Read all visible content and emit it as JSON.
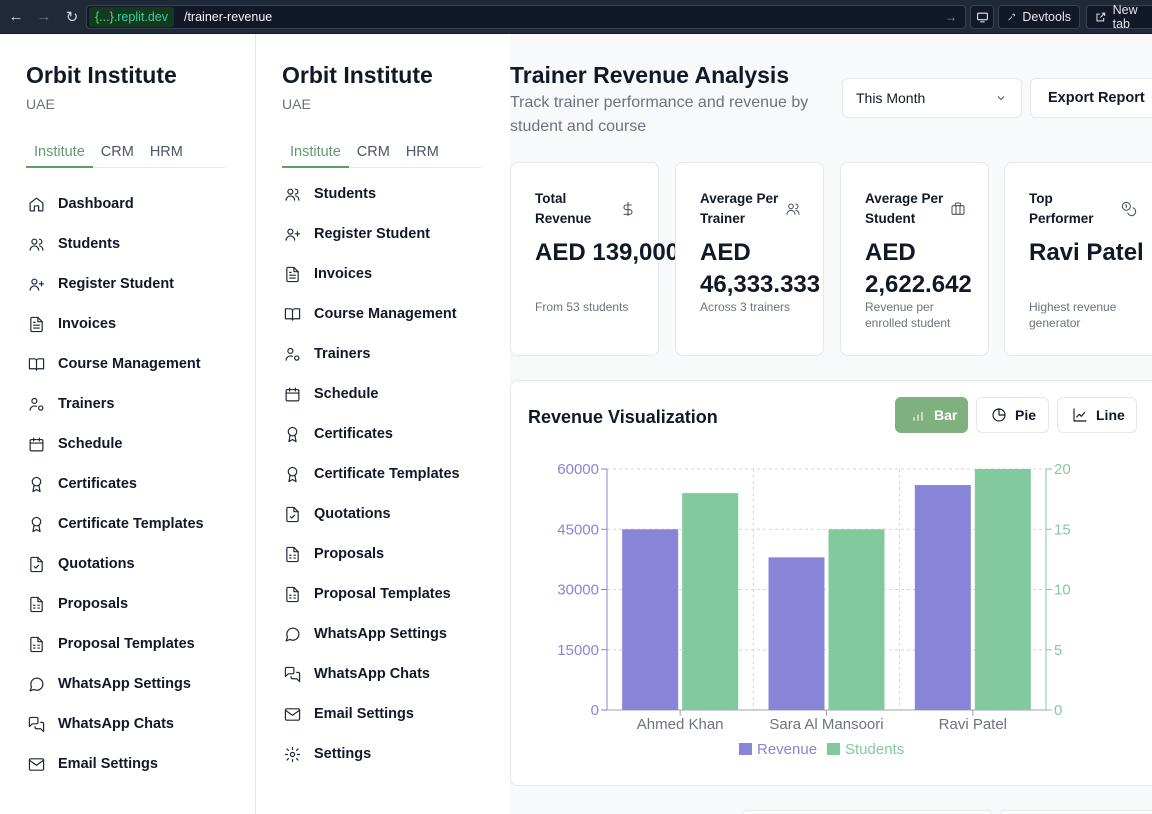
{
  "browser": {
    "url_domain_brace": "{...}",
    "url_domain": ".replit.dev",
    "url_path": "/trainer-revenue",
    "devtools_label": "Devtools",
    "newtab_label": "New tab"
  },
  "sidebar": {
    "title": "Orbit Institute",
    "subtitle": "UAE",
    "tabs": [
      "Institute",
      "CRM",
      "HRM"
    ],
    "active_tab": "Institute",
    "items_left": [
      {
        "label": "Dashboard",
        "icon": "home-icon"
      },
      {
        "label": "Students",
        "icon": "users-icon"
      },
      {
        "label": "Register Student",
        "icon": "user-plus-icon"
      },
      {
        "label": "Invoices",
        "icon": "file-text-icon"
      },
      {
        "label": "Course Management",
        "icon": "book-open-icon"
      },
      {
        "label": "Trainers",
        "icon": "user-cog-icon"
      },
      {
        "label": "Schedule",
        "icon": "calendar-icon"
      },
      {
        "label": "Certificates",
        "icon": "award-icon"
      },
      {
        "label": "Certificate Templates",
        "icon": "award-icon"
      },
      {
        "label": "Quotations",
        "icon": "file-check-icon"
      },
      {
        "label": "Proposals",
        "icon": "file-spreadsheet-icon"
      },
      {
        "label": "Proposal Templates",
        "icon": "file-spreadsheet-icon"
      },
      {
        "label": "WhatsApp Settings",
        "icon": "message-circle-icon"
      },
      {
        "label": "WhatsApp Chats",
        "icon": "messages-square-icon"
      },
      {
        "label": "Email Settings",
        "icon": "mail-icon"
      }
    ],
    "items_right": [
      {
        "label": "Students",
        "icon": "users-icon"
      },
      {
        "label": "Register Student",
        "icon": "user-plus-icon"
      },
      {
        "label": "Invoices",
        "icon": "file-text-icon"
      },
      {
        "label": "Course Management",
        "icon": "book-open-icon"
      },
      {
        "label": "Trainers",
        "icon": "user-cog-icon"
      },
      {
        "label": "Schedule",
        "icon": "calendar-icon"
      },
      {
        "label": "Certificates",
        "icon": "award-icon"
      },
      {
        "label": "Certificate Templates",
        "icon": "award-icon"
      },
      {
        "label": "Quotations",
        "icon": "file-check-icon"
      },
      {
        "label": "Proposals",
        "icon": "file-spreadsheet-icon"
      },
      {
        "label": "Proposal Templates",
        "icon": "file-spreadsheet-icon"
      },
      {
        "label": "WhatsApp Settings",
        "icon": "message-circle-icon"
      },
      {
        "label": "WhatsApp Chats",
        "icon": "messages-square-icon"
      },
      {
        "label": "Email Settings",
        "icon": "mail-icon"
      },
      {
        "label": "Settings",
        "icon": "settings-icon"
      }
    ]
  },
  "header": {
    "title": "Trainer Revenue Analysis",
    "subtitle": "Track trainer performance and revenue by student and course",
    "period": "This Month",
    "export_label": "Export Report"
  },
  "stats": [
    {
      "label": "Total Revenue",
      "value": "AED 139,000",
      "note": "From 53 students",
      "icon": "dollar-sign-icon"
    },
    {
      "label": "Average Per Trainer",
      "value": "AED 46,333.333",
      "note": "Across 3 trainers",
      "icon": "users-icon"
    },
    {
      "label": "Average Per Student",
      "value": "AED 2,622.642",
      "note": "Revenue per enrolled student",
      "icon": "briefcase-icon"
    },
    {
      "label": "Top Performer",
      "value": "Ravi Patel",
      "note": "Highest revenue generator",
      "icon": "coins-icon"
    }
  ],
  "visualization": {
    "title": "Revenue Visualization",
    "buttons": [
      "Bar",
      "Pie",
      "Line"
    ],
    "active": "Bar"
  },
  "colors": {
    "accent": "#7fb07f",
    "revenue": "#8884d8",
    "students": "#82ca9d"
  },
  "chart_data": {
    "type": "bar",
    "categories": [
      "Ahmed Khan",
      "Sara Al Mansoori",
      "Ravi Patel"
    ],
    "series": [
      {
        "name": "Revenue",
        "values": [
          45000,
          38000,
          56000
        ],
        "axis": "left"
      },
      {
        "name": "Students",
        "values": [
          18,
          15,
          20
        ],
        "axis": "right"
      }
    ],
    "y_left_ticks": [
      0,
      15000,
      30000,
      45000,
      60000
    ],
    "y_right_ticks": [
      0,
      5,
      10,
      15,
      20
    ],
    "ylim_left": [
      0,
      60000
    ],
    "ylim_right": [
      0,
      20
    ],
    "legend": "bottom",
    "grid": true
  }
}
